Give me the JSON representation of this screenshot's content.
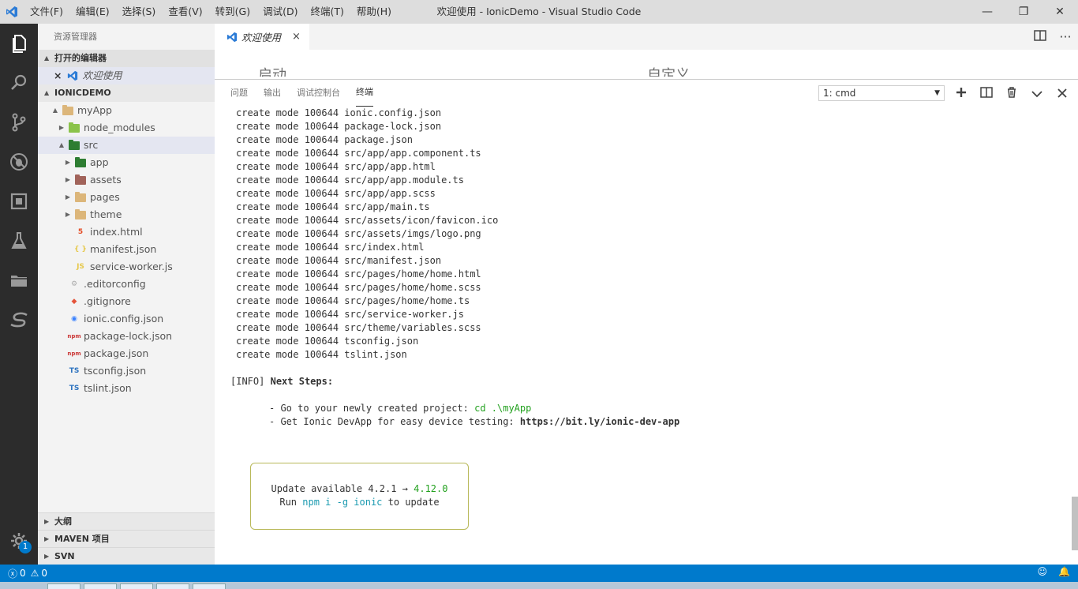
{
  "window": {
    "title": "欢迎使用 - IonicDemo - Visual Studio Code",
    "controls": [
      "—",
      "❐",
      "✕"
    ]
  },
  "menu": [
    "文件(F)",
    "编辑(E)",
    "选择(S)",
    "查看(V)",
    "转到(G)",
    "调试(D)",
    "终端(T)",
    "帮助(H)"
  ],
  "activity_bar": {
    "items": [
      "explorer-icon",
      "search-icon",
      "source-control-icon",
      "debug-icon",
      "extensions-icon",
      "test-icon",
      "folder-icon",
      "svn-icon"
    ],
    "settings_badge": "1"
  },
  "sidebar": {
    "title": "资源管理器",
    "open_editors": {
      "header": "打开的编辑器",
      "items": [
        {
          "label": "欢迎使用",
          "close": "×"
        }
      ]
    },
    "workspace": {
      "header": "IONICDEMO",
      "tree": [
        {
          "label": "myApp",
          "twist": "▲",
          "icon": "folder",
          "color": "#dcb67a",
          "depth": 1
        },
        {
          "label": "node_modules",
          "twist": "▶",
          "icon": "folder",
          "color": "#8bc34a",
          "depth": 2
        },
        {
          "label": "src",
          "twist": "▲",
          "icon": "folder",
          "color": "#2e7d32",
          "depth": 2,
          "selected": true
        },
        {
          "label": "app",
          "twist": "▶",
          "icon": "folder",
          "color": "#2e7d32",
          "depth": 3
        },
        {
          "label": "assets",
          "twist": "▶",
          "icon": "folder",
          "color": "#a1635a",
          "depth": 3
        },
        {
          "label": "pages",
          "twist": "▶",
          "icon": "folder",
          "color": "#dcb67a",
          "depth": 3
        },
        {
          "label": "theme",
          "twist": "▶",
          "icon": "folder",
          "color": "#dcb67a",
          "depth": 3
        },
        {
          "label": "index.html",
          "twist": "",
          "icon": "html",
          "glyph": "5",
          "color": "#e44d26",
          "depth": 3
        },
        {
          "label": "manifest.json",
          "twist": "",
          "icon": "json",
          "glyph": "{ }",
          "color": "#e6c84a",
          "depth": 3
        },
        {
          "label": "service-worker.js",
          "twist": "",
          "icon": "js",
          "glyph": "JS",
          "color": "#e6c84a",
          "depth": 3
        },
        {
          "label": ".editorconfig",
          "twist": "",
          "icon": "config",
          "glyph": "⚙",
          "color": "#aaaaaa",
          "depth": 2
        },
        {
          "label": ".gitignore",
          "twist": "",
          "icon": "git",
          "glyph": "◆",
          "color": "#e4533a",
          "depth": 2
        },
        {
          "label": "ionic.config.json",
          "twist": "",
          "icon": "ionic",
          "glyph": "◉",
          "color": "#3880ff",
          "depth": 2
        },
        {
          "label": "package-lock.json",
          "twist": "",
          "icon": "npm",
          "glyph": "npm",
          "color": "#cb3837",
          "depth": 2
        },
        {
          "label": "package.json",
          "twist": "",
          "icon": "npm",
          "glyph": "npm",
          "color": "#cb3837",
          "depth": 2
        },
        {
          "label": "tsconfig.json",
          "twist": "",
          "icon": "ts",
          "glyph": "TS",
          "color": "#2f74c0",
          "depth": 2
        },
        {
          "label": "tslint.json",
          "twist": "",
          "icon": "tslint",
          "glyph": "TS",
          "color": "#2f74c0",
          "depth": 2
        }
      ]
    },
    "bottom_sections": [
      "大纲",
      "MAVEN 项目",
      "SVN"
    ]
  },
  "editor": {
    "tab_label": "欢迎使用",
    "tab_close": "×",
    "welcome_peek": {
      "left": "启动",
      "right": "自定义"
    }
  },
  "panel": {
    "tabs": [
      "问题",
      "输出",
      "调试控制台",
      "终端"
    ],
    "active_tab": "终端",
    "terminal_select": "1: cmd",
    "actions": [
      "＋",
      "▥",
      "🗑",
      "⌄",
      "✕"
    ]
  },
  "terminal": {
    "create_lines": [
      "create mode 100644 ionic.config.json",
      "create mode 100644 package-lock.json",
      "create mode 100644 package.json",
      "create mode 100644 src/app/app.component.ts",
      "create mode 100644 src/app/app.html",
      "create mode 100644 src/app/app.module.ts",
      "create mode 100644 src/app/app.scss",
      "create mode 100644 src/app/main.ts",
      "create mode 100644 src/assets/icon/favicon.ico",
      "create mode 100644 src/assets/imgs/logo.png",
      "create mode 100644 src/index.html",
      "create mode 100644 src/manifest.json",
      "create mode 100644 src/pages/home/home.html",
      "create mode 100644 src/pages/home/home.scss",
      "create mode 100644 src/pages/home/home.ts",
      "create mode 100644 src/service-worker.js",
      "create mode 100644 src/theme/variables.scss",
      "create mode 100644 tsconfig.json",
      "create mode 100644 tslint.json"
    ],
    "info_prefix": "[INFO]",
    "info_text": "Next Steps:",
    "step1_text": "- Go to your newly created project: ",
    "step1_cmd": "cd .\\myApp",
    "step2_text": "- Get Ionic DevApp for easy device testing: ",
    "step2_link": "https://bit.ly/ionic-dev-app",
    "update": {
      "line1_text": "Update available 4.2.1 → ",
      "line1_version": "4.12.0",
      "line2_prefix": "Run ",
      "line2_cmd": "npm i -g ionic",
      "line2_suffix": " to update"
    }
  },
  "statusbar": {
    "errors": "0",
    "warnings": "0"
  }
}
